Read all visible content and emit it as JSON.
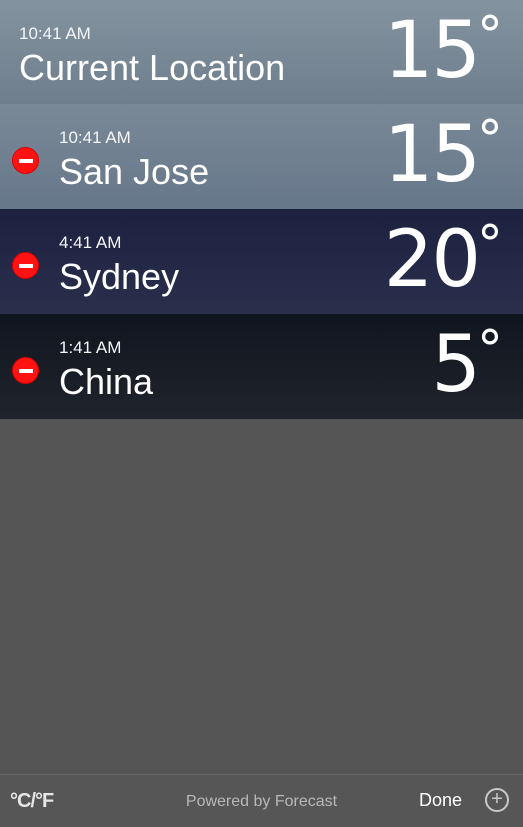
{
  "locations": [
    {
      "time": "10:41 AM",
      "city": "Current Location",
      "temp": "15",
      "unit": "°"
    },
    {
      "time": "10:41 AM",
      "city": "San Jose",
      "temp": "15",
      "unit": "°"
    },
    {
      "time": "4:41 AM",
      "city": "Sydney",
      "temp": "20",
      "unit": "°"
    },
    {
      "time": "1:41 AM",
      "city": "China",
      "temp": "5",
      "unit": "°"
    }
  ],
  "footer": {
    "unit_toggle": "°C/°F",
    "powered_by": "Powered by Forecast",
    "done_label": "Done",
    "add_label": "+"
  },
  "colors": {
    "delete_button": "#ff1212",
    "background": "#555555"
  },
  "icons": {
    "delete": "minus-circle-icon",
    "add": "plus-circle-icon"
  }
}
